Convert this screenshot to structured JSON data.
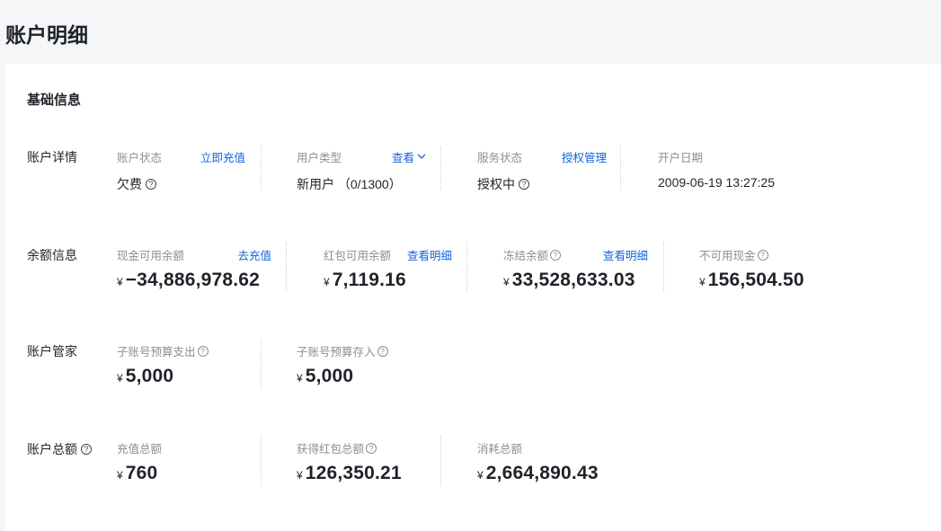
{
  "page_title": "账户明细",
  "section_title": "基础信息",
  "account_details": {
    "label": "账户详情",
    "status": {
      "label": "账户状态",
      "link": "立即充值",
      "value": "欠费"
    },
    "user_type": {
      "label": "用户类型",
      "link": "查看",
      "value": "新用户 （0/1300）"
    },
    "service_status": {
      "label": "服务状态",
      "link": "授权管理",
      "value": "授权中"
    },
    "open_date": {
      "label": "开户日期",
      "value": "2009-06-19 13:27:25"
    }
  },
  "balance": {
    "label": "余额信息",
    "cash": {
      "label": "现金可用余额",
      "link": "去充值",
      "currency": "¥",
      "value": "−34,886,978.62"
    },
    "coupon": {
      "label": "红包可用余额",
      "link": "查看明细",
      "currency": "¥",
      "value": "7,119.16"
    },
    "frozen": {
      "label": "冻结余额",
      "link": "查看明细",
      "currency": "¥",
      "value": "33,528,633.03"
    },
    "unavailable": {
      "label": "不可用现金",
      "currency": "¥",
      "value": "156,504.50"
    }
  },
  "steward": {
    "label": "账户管家",
    "sub_out": {
      "label": "子账号预算支出",
      "currency": "¥",
      "value": "5,000"
    },
    "sub_in": {
      "label": "子账号预算存入",
      "currency": "¥",
      "value": "5,000"
    }
  },
  "totals": {
    "label": "账户总额",
    "recharge": {
      "label": "充值总额",
      "currency": "¥",
      "value": "760"
    },
    "coupon_total": {
      "label": "获得红包总额",
      "currency": "¥",
      "value": "126,350.21"
    },
    "consumed": {
      "label": "消耗总额",
      "currency": "¥",
      "value": "2,664,890.43"
    }
  },
  "icons": {
    "help": "?"
  }
}
